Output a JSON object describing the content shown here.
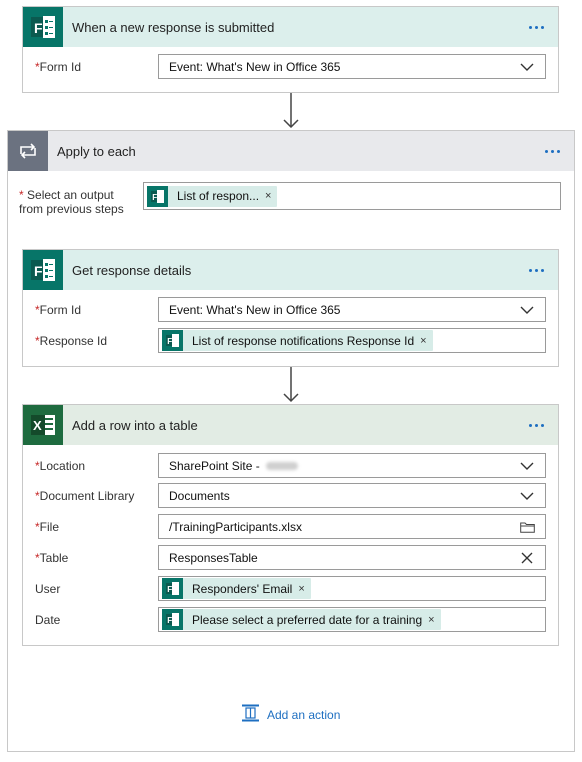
{
  "trigger": {
    "title": "When a new response is submitted",
    "fields": [
      {
        "label": "Form Id",
        "value": "Event: What's New in Office 365"
      }
    ]
  },
  "loop": {
    "title": "Apply to each",
    "select_label_line1": "Select an output",
    "select_label_line2": "from previous steps",
    "select_token": "List of respon..."
  },
  "get_details": {
    "title": "Get response details",
    "form_id_label": "Form Id",
    "form_id_value": "Event: What's New in Office 365",
    "response_id_label": "Response Id",
    "response_id_token": "List of response notifications Response Id"
  },
  "add_row": {
    "title": "Add a row into a table",
    "location_label": "Location",
    "location_value": "SharePoint Site -",
    "doclib_label": "Document Library",
    "doclib_value": "Documents",
    "file_label": "File",
    "file_value": "/TrainingParticipants.xlsx",
    "table_label": "Table",
    "table_value": "ResponsesTable",
    "user_label": "User",
    "user_token": "Responders' Email",
    "date_label": "Date",
    "date_token": "Please select a preferred date for a training"
  },
  "add_action_label": "Add an action",
  "required_marker": "*",
  "more_label": "...",
  "token_close": "×",
  "colors": {
    "forms_brand": "#077568",
    "excel_brand": "#1e6b3f",
    "loop_grey": "#6b7280",
    "link_blue": "#1e6fc1",
    "required_red": "#c62828"
  },
  "icons": [
    "forms-icon",
    "loop-icon",
    "excel-icon",
    "chevron-down-icon",
    "folder-icon",
    "clear-icon",
    "more-icon",
    "add-action-icon",
    "arrow-down-icon"
  ]
}
